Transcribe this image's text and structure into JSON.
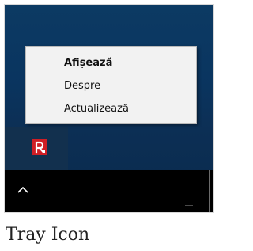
{
  "context_menu": {
    "items": [
      {
        "label": "Afișează",
        "default": true
      },
      {
        "label": "Despre",
        "default": false
      },
      {
        "label": "Actualizează",
        "default": false
      }
    ]
  },
  "tray": {
    "app_icon": "antivirus-tray-icon",
    "overflow_icon": "chevron-up-icon"
  },
  "colors": {
    "desktop_blue": "#0b3560",
    "taskbar": "#000000",
    "menu_background": "#f2f2f2",
    "app_icon_red": "#d01e25"
  },
  "caption": "Tray Icon"
}
